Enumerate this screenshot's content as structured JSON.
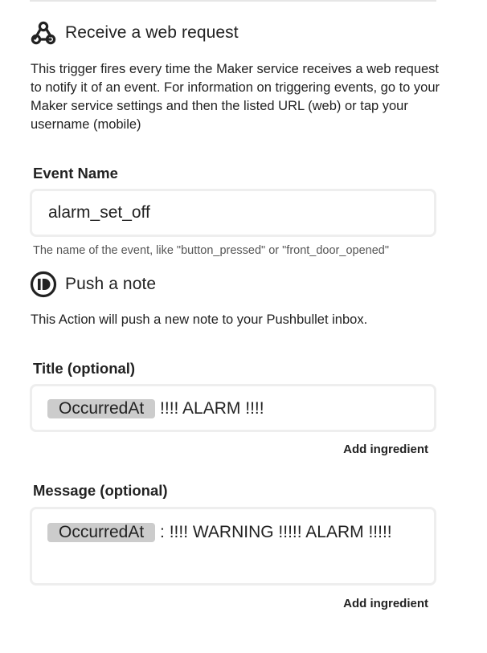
{
  "trigger": {
    "title": "Receive a web request",
    "icon": "webhook-icon",
    "description": "This trigger fires every time the Maker service receives a web request to notify it of an event. For information on triggering events, go to your Maker service settings and then the listed URL (web) or tap your username (mobile)",
    "event_field": {
      "label": "Event Name",
      "value": "alarm_set_off",
      "helper": "The name of the event, like \"button_pressed\" or \"front_door_opened\""
    }
  },
  "action": {
    "title": "Push a note",
    "icon": "pushbullet-icon",
    "description": "This Action will push a new note to your Pushbullet inbox.",
    "title_field": {
      "label": "Title (optional)",
      "ingredient": "OccurredAt",
      "text": " !!!! ALARM !!!!",
      "add_label": "Add ingredient"
    },
    "message_field": {
      "label": "Message (optional)",
      "ingredient": "OccurredAt",
      "text": " : !!!! WARNING !!!!! ALARM !!!!!",
      "add_label": "Add ingredient"
    }
  },
  "colors": {
    "text": "#222222",
    "field_border": "#eeeeee",
    "ingredient_pill": "#cccccc",
    "helper_text": "#555555"
  }
}
